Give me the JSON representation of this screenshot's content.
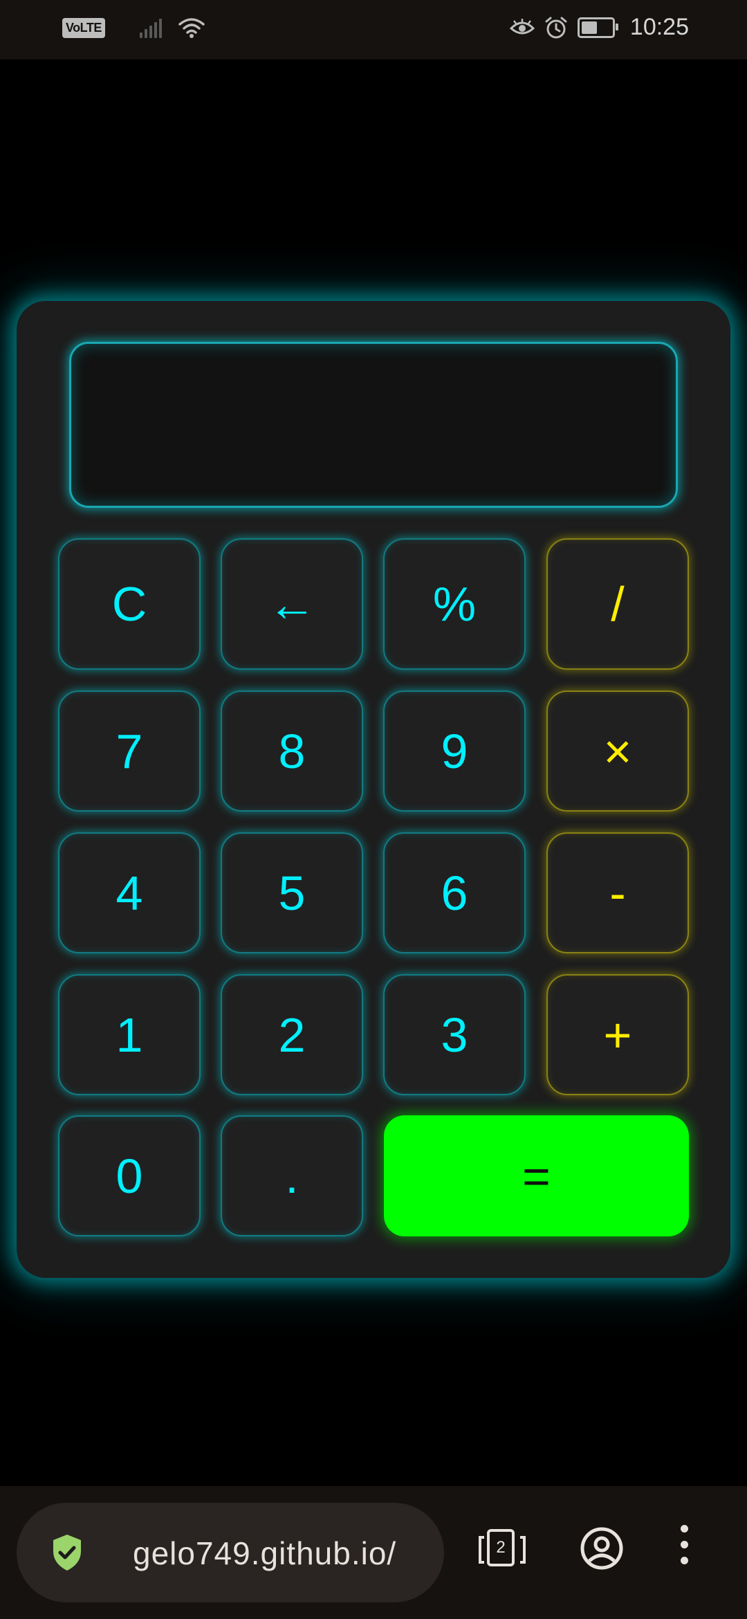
{
  "status_bar": {
    "volte_label": "VoLTE",
    "time": "10:25",
    "icons": [
      "volte-icon",
      "signal-icon",
      "wifi-icon",
      "eye-icon",
      "alarm-icon",
      "battery-icon"
    ]
  },
  "calculator": {
    "display_value": "",
    "keys": {
      "clear": "C",
      "backspace": "←",
      "percent": "%",
      "divide": "/",
      "seven": "7",
      "eight": "8",
      "nine": "9",
      "multiply": "×",
      "four": "4",
      "five": "5",
      "six": "6",
      "minus": "-",
      "one": "1",
      "two": "2",
      "three": "3",
      "plus": "+",
      "zero": "0",
      "decimal": ".",
      "equals": "="
    },
    "colors": {
      "digit_text": "#00f0ff",
      "operator_text": "#ffee00",
      "equals_bg": "#00ff00",
      "glow": "#1aa8b3"
    }
  },
  "browser_bar": {
    "url_text": "gelo749.github.io/",
    "tab_count": "2",
    "icons": [
      "shield-check-icon",
      "tabs-icon",
      "account-icon",
      "more-vert-icon"
    ]
  }
}
